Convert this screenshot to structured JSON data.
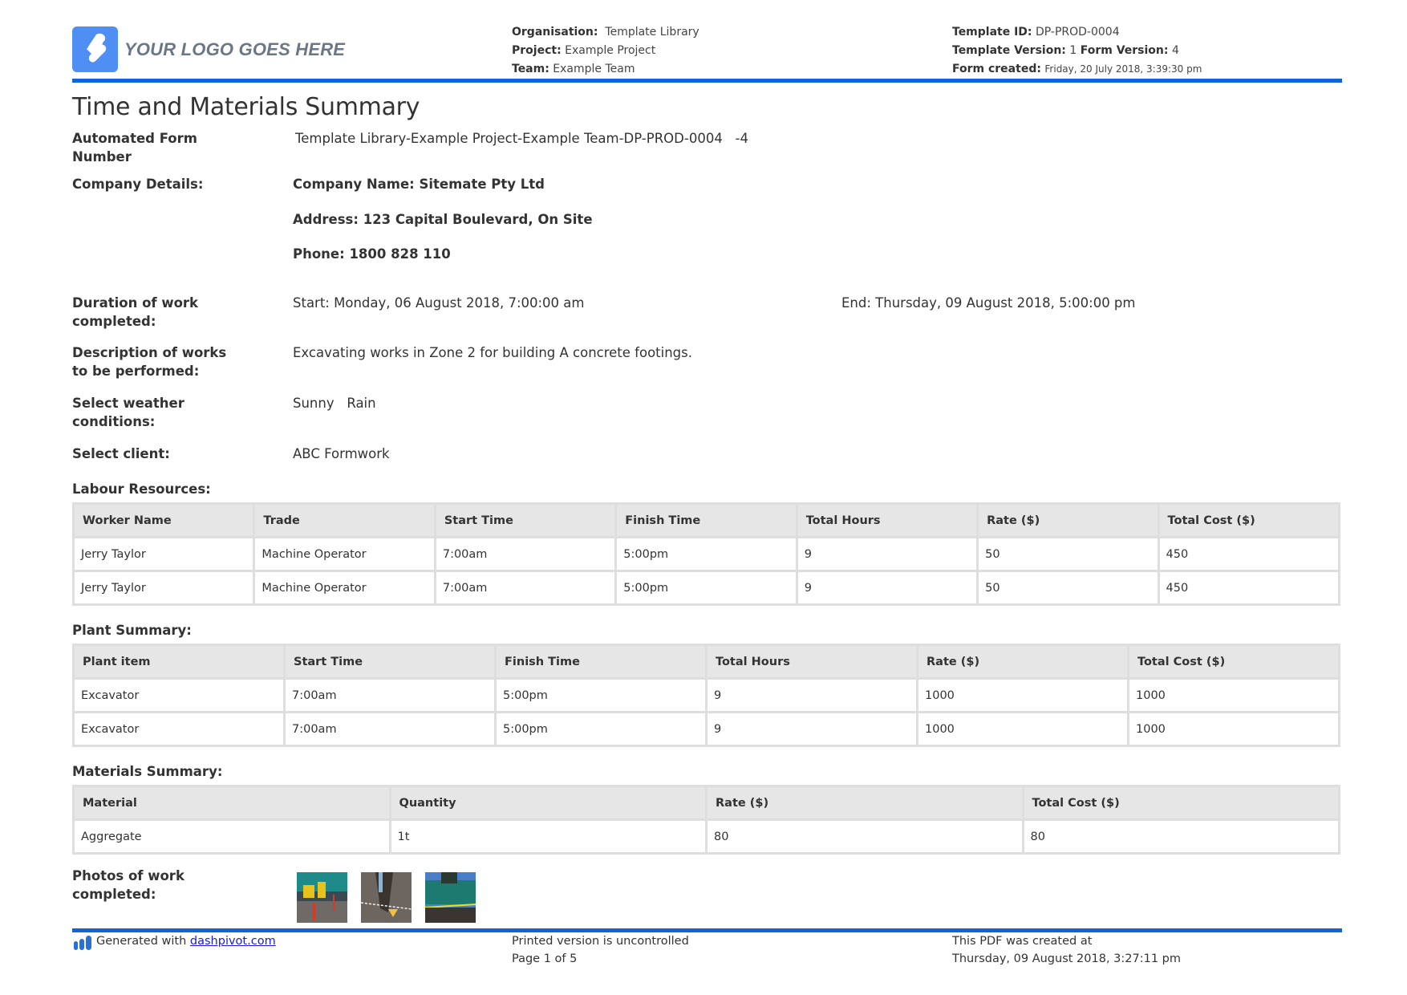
{
  "header": {
    "logo_text": "YOUR LOGO GOES HERE",
    "organisation_label": "Organisation:",
    "organisation_value": "Template Library",
    "project_label": "Project:",
    "project_value": "Example Project",
    "team_label": "Team:",
    "team_value": "Example Team",
    "template_id_label": "Template ID:",
    "template_id_value": "DP-PROD-0004",
    "template_version_label": "Template Version:",
    "template_version_value": "1",
    "form_version_label": "Form Version:",
    "form_version_value": "4",
    "form_created_label": "Form created:",
    "form_created_value": "Friday, 20 July 2018, 3:39:30 pm",
    "accent_color": "#0f64d8",
    "logo_color": "#4f8ef2"
  },
  "title": "Time and Materials Summary",
  "fields": {
    "automated_form_number_label": "Automated Form Number",
    "automated_form_number_value": "Template Library-Example Project-Example Team-DP-PROD-0004   -4",
    "company_details_label": "Company Details:",
    "company_name": "Company Name: Sitemate Pty Ltd",
    "company_address": "Address: 123 Capital Boulevard, On Site",
    "company_phone": "Phone: 1800 828 110",
    "duration_label": "Duration of work completed:",
    "duration_start": "Start: Monday, 06 August 2018, 7:00:00 am",
    "duration_end": "End: Thursday, 09 August 2018, 5:00:00 pm",
    "description_label": "Description of works to be performed:",
    "description_value": "Excavating works in Zone 2 for building A concrete footings.",
    "weather_label": "Select weather conditions:",
    "weather_value": "Sunny   Rain",
    "client_label": "Select client:",
    "client_value": "ABC Formwork",
    "photos_label": "Photos of work completed:"
  },
  "labour": {
    "title": "Labour Resources:",
    "columns": [
      "Worker Name",
      "Trade",
      "Start Time",
      "Finish Time",
      "Total Hours",
      "Rate ($)",
      "Total Cost ($)"
    ],
    "rows": [
      [
        "Jerry Taylor",
        "Machine Operator",
        "7:00am",
        "5:00pm",
        "9",
        "50",
        "450"
      ],
      [
        "Jerry Taylor",
        "Machine Operator",
        "7:00am",
        "5:00pm",
        "9",
        "50",
        "450"
      ]
    ]
  },
  "plant": {
    "title": "Plant Summary:",
    "columns": [
      "Plant item",
      "Start Time",
      "Finish Time",
      "Total Hours",
      "Rate ($)",
      "Total Cost ($)"
    ],
    "rows": [
      [
        "Excavator",
        "7:00am",
        "5:00pm",
        "9",
        "1000",
        "1000"
      ],
      [
        "Excavator",
        "7:00am",
        "5:00pm",
        "9",
        "1000",
        "1000"
      ]
    ]
  },
  "materials": {
    "title": "Materials Summary:",
    "columns": [
      "Material",
      "Quantity",
      "Rate ($)",
      "Total Cost ($)"
    ],
    "rows": [
      [
        "Aggregate",
        "1t",
        "80",
        "80"
      ]
    ]
  },
  "photos": [
    {
      "icon": "excavator-photo-1"
    },
    {
      "icon": "trench-photo-2"
    },
    {
      "icon": "excavator-photo-3"
    }
  ],
  "footer": {
    "generated_with": "Generated with ",
    "link_text": "dashpivot.com",
    "uncontrolled": "Printed version is uncontrolled",
    "page": "Page 1 of 5",
    "pdf_created_label": "This PDF was created at",
    "pdf_created_value": "Thursday, 09 August 2018, 3:27:11 pm"
  }
}
